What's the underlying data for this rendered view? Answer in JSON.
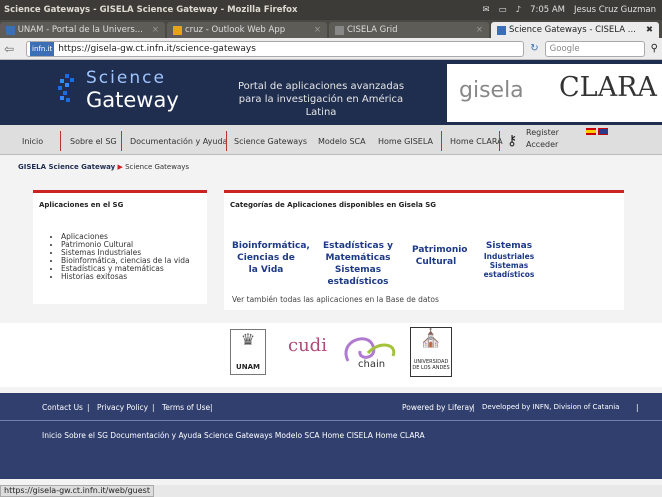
{
  "window": {
    "title": "Science Gateways - GISELA Science Gateway - Mozilla Firefox",
    "clock": "7:05 AM",
    "user": "Jesus Cruz Guzman"
  },
  "tabs": [
    {
      "label": "UNAM - Portal de la Univers..."
    },
    {
      "label": "cruz - Outlook Web App"
    },
    {
      "label": "CISELA Grid"
    },
    {
      "label": "Science Gateways - CISELA ..."
    }
  ],
  "nav": {
    "ident": "infn.it",
    "url": "https://gisela-gw.ct.infn.it/science-gateways",
    "search_placeholder": "Google"
  },
  "header": {
    "logo_line1": "Science",
    "logo_line2": "Gateway",
    "portal_line1": "Portal de aplicaciones avanzadas",
    "portal_line2": "para la investigación en América Latina",
    "partner1": "gisela",
    "partner2": "CLARA"
  },
  "menu": {
    "items": [
      "Inicio",
      "Sobre el SG",
      "Documentación y Ayuda",
      "Science Gateways",
      "Modelo SCA",
      "Home GISELA",
      "Home CLARA"
    ],
    "register": "Register",
    "login": "Acceder"
  },
  "breadcrumb": {
    "home": "GISELA Science Gateway",
    "current": "Science Gateways"
  },
  "apps_box": {
    "title": "Aplicaciones en el SG",
    "items": [
      "Aplicaciones",
      "Patrimonio Cultural",
      "Sistemas Industriales",
      "Bioinformática, ciencias de la vida",
      "Estadísticas y matemáticas",
      "Historias exitosas"
    ]
  },
  "categories_box": {
    "title": "Categorías de Aplicaciones disponibles en Gisela SG",
    "cat1": "Bioinformática, Ciencias de la Vida",
    "cat2": "Estadísticas y Matemáticas Sistemas estadísticos",
    "cat3": "Patrimonio Cultural",
    "cat4a": "Sistemas",
    "cat4b": "Industriales Sistemas estadísticos",
    "see_all": "Ver también todas las aplicaciones en la Base de datos"
  },
  "sponsors": [
    "UNAM",
    "cudi",
    "chain",
    "UNIVERSIDAD DE LOS ANDES"
  ],
  "footer": {
    "contact": "Contact Us",
    "privacy": "Privacy Policy",
    "terms": "Terms of Use",
    "powered": "Powered by Liferay",
    "developed": "Developed by INFN, Division of Catania",
    "links": "Inicio  Sobre el SG  Documentación y Ayuda  Science Gateways  Modelo SCA  Home CISELA  Home CLARA"
  },
  "status": {
    "url": "https://gisela-gw.ct.infn.it/web/guest"
  }
}
